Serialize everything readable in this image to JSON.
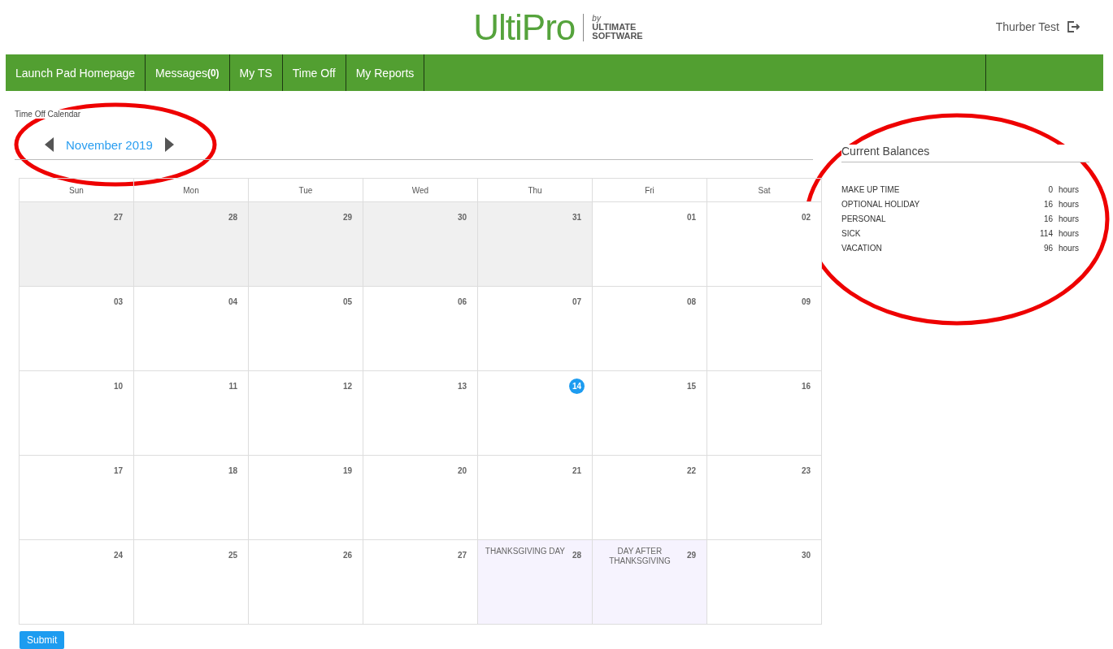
{
  "header": {
    "logo": {
      "brand": "UltiPro",
      "by": "by",
      "maker_line_1": "ULTIMATE",
      "maker_line_2": "SOFTWARE"
    },
    "user": "Thurber Test"
  },
  "nav": [
    {
      "label": "Launch Pad Homepage"
    },
    {
      "label": "Messages",
      "count": "(0)"
    },
    {
      "label": "My TS"
    },
    {
      "label": "Time Off"
    },
    {
      "label": "My Reports"
    }
  ],
  "page_title": "Time Off Calendar",
  "month": "November 2019",
  "calendar": {
    "weekdays": [
      "Sun",
      "Mon",
      "Tue",
      "Wed",
      "Thu",
      "Fri",
      "Sat"
    ],
    "weeks": [
      [
        {
          "day": "27",
          "kind": "other"
        },
        {
          "day": "28",
          "kind": "other"
        },
        {
          "day": "29",
          "kind": "other"
        },
        {
          "day": "30",
          "kind": "other"
        },
        {
          "day": "31",
          "kind": "other"
        },
        {
          "day": "01",
          "kind": "normal"
        },
        {
          "day": "02",
          "kind": "normal"
        }
      ],
      [
        {
          "day": "03",
          "kind": "normal"
        },
        {
          "day": "04",
          "kind": "normal"
        },
        {
          "day": "05",
          "kind": "normal"
        },
        {
          "day": "06",
          "kind": "normal"
        },
        {
          "day": "07",
          "kind": "normal"
        },
        {
          "day": "08",
          "kind": "normal"
        },
        {
          "day": "09",
          "kind": "normal"
        }
      ],
      [
        {
          "day": "10",
          "kind": "normal"
        },
        {
          "day": "11",
          "kind": "normal"
        },
        {
          "day": "12",
          "kind": "normal"
        },
        {
          "day": "13",
          "kind": "normal"
        },
        {
          "day": "14",
          "kind": "today"
        },
        {
          "day": "15",
          "kind": "normal"
        },
        {
          "day": "16",
          "kind": "normal"
        }
      ],
      [
        {
          "day": "17",
          "kind": "normal"
        },
        {
          "day": "18",
          "kind": "normal"
        },
        {
          "day": "19",
          "kind": "normal"
        },
        {
          "day": "20",
          "kind": "normal"
        },
        {
          "day": "21",
          "kind": "normal"
        },
        {
          "day": "22",
          "kind": "normal"
        },
        {
          "day": "23",
          "kind": "normal"
        }
      ],
      [
        {
          "day": "24",
          "kind": "normal"
        },
        {
          "day": "25",
          "kind": "normal"
        },
        {
          "day": "26",
          "kind": "normal"
        },
        {
          "day": "27",
          "kind": "normal"
        },
        {
          "day": "28",
          "kind": "holiday",
          "label": "THANKSGIVING DAY"
        },
        {
          "day": "29",
          "kind": "holiday",
          "label": "DAY AFTER THANKSGIVING"
        },
        {
          "day": "30",
          "kind": "normal"
        }
      ]
    ]
  },
  "balances": {
    "title": "Current Balances",
    "rows": [
      {
        "name": "MAKE UP TIME",
        "amount": "0",
        "unit": "hours"
      },
      {
        "name": "OPTIONAL HOLIDAY",
        "amount": "16",
        "unit": "hours"
      },
      {
        "name": "PERSONAL",
        "amount": "16",
        "unit": "hours"
      },
      {
        "name": "SICK",
        "amount": "114",
        "unit": "hours"
      },
      {
        "name": "VACATION",
        "amount": "96",
        "unit": "hours"
      }
    ]
  },
  "submit": "Submit"
}
